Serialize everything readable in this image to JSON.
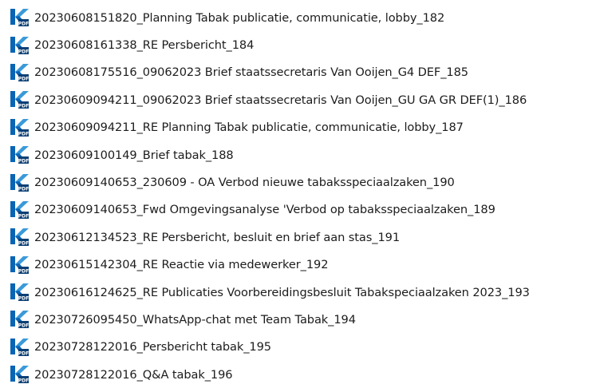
{
  "file_icon": {
    "name": "kofax-pdf-file-icon",
    "label": "PDF",
    "brand_color": "#0a64b4",
    "accent_color": "#3a9ad9",
    "tag_color": "#0a3f75"
  },
  "files": [
    "20230608151820_Planning Tabak publicatie, communicatie, lobby_182",
    "20230608161338_RE Persbericht_184",
    "20230608175516_09062023 Brief staatssecretaris Van Ooijen_G4 DEF_185",
    "20230609094211_09062023 Brief staatssecretaris Van Ooijen_GU GA GR DEF(1)_186",
    "20230609094211_RE Planning Tabak publicatie, communicatie, lobby_187",
    "20230609100149_Brief tabak_188",
    "20230609140653_230609 - OA Verbod nieuwe tabaksspeciaalzaken_190",
    "20230609140653_Fwd Omgevingsanalyse 'Verbod op tabaksspeciaalzaken_189",
    "20230612134523_RE Persbericht, besluit en brief aan stas_191",
    "20230615142304_RE Reactie via medewerker_192",
    "20230616124625_RE Publicaties Voorbereidingsbesluit Tabakspeciaalzaken 2023_193",
    "20230726095450_WhatsApp-chat met Team Tabak_194",
    "20230728122016_Persbericht tabak_195",
    "20230728122016_Q&A tabak_196"
  ]
}
